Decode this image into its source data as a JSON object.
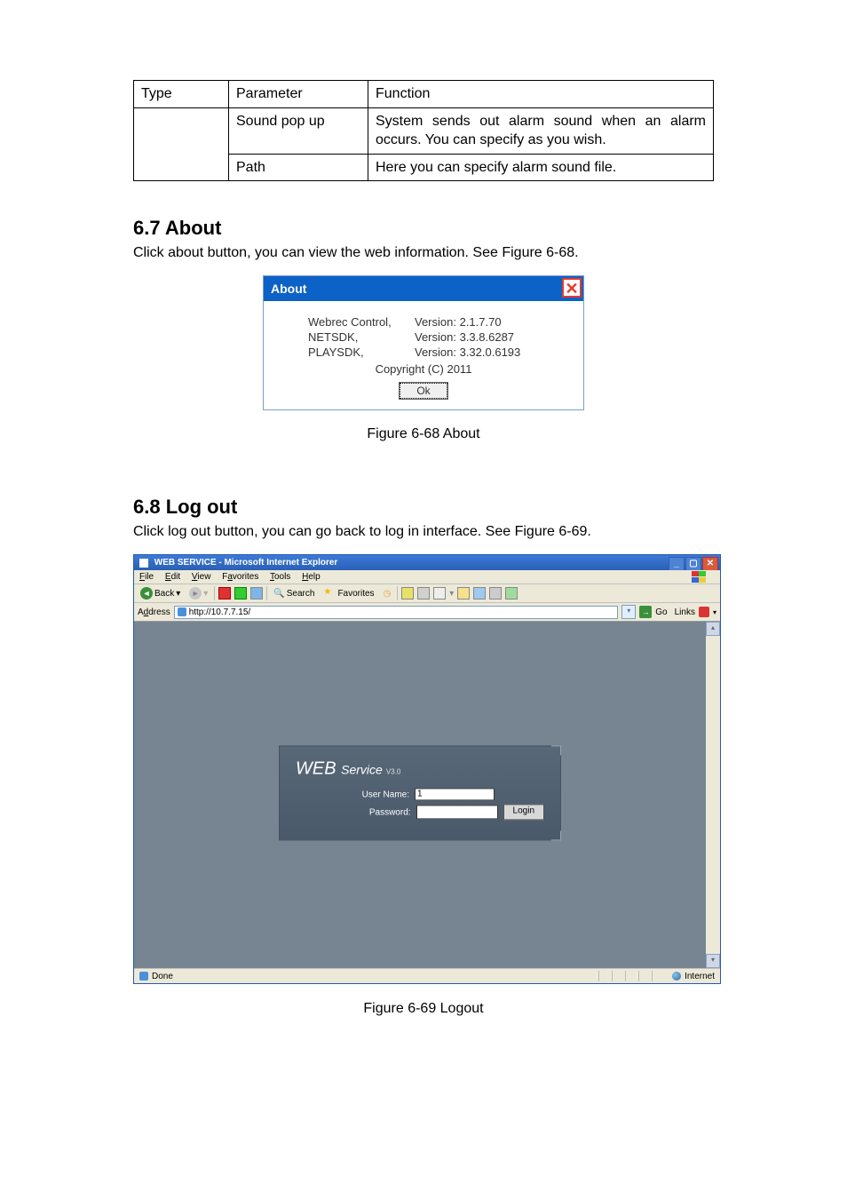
{
  "table": {
    "headers": [
      "Type",
      "Parameter",
      "Function"
    ],
    "rows": [
      {
        "type": "",
        "param": "Sound pop up",
        "func": "System sends out alarm sound when an alarm occurs. You can specify as you wish."
      },
      {
        "type": "",
        "param": "Path",
        "func": "Here you can specify alarm sound file."
      }
    ]
  },
  "section_about": {
    "heading": "6.7  About",
    "text": "Click about button, you can view the web information. See Figure 6-68.",
    "dialog": {
      "title": "About",
      "rows": [
        {
          "label": "Webrec Control,",
          "value": "Version: 2.1.7.70"
        },
        {
          "label": "NETSDK,",
          "value": "Version: 3.3.8.6287"
        },
        {
          "label": "PLAYSDK,",
          "value": "Version: 3.32.0.6193"
        }
      ],
      "copyright": "Copyright (C) 2011",
      "ok": "Ok"
    },
    "caption": "Figure 6-68 About"
  },
  "section_logout": {
    "heading": "6.8  Log out",
    "text": "Click log out button, you can go back to log in interface. See Figure 6-69.",
    "caption": "Figure 6-69 Logout"
  },
  "ie": {
    "title": "WEB SERVICE - Microsoft Internet Explorer",
    "menus": [
      "File",
      "Edit",
      "View",
      "Favorites",
      "Tools",
      "Help"
    ],
    "toolbar": {
      "back": "Back",
      "search": "Search",
      "favorites": "Favorites"
    },
    "addressbar": {
      "label": "Address",
      "value": "http://10.7.7.15/",
      "go": "Go",
      "links": "Links"
    },
    "login": {
      "brand": "WEB",
      "service": "Service",
      "version": "V3.0",
      "username_label": "User Name:",
      "password_label": "Password:",
      "username_value": "1",
      "login_btn": "Login"
    },
    "status": {
      "done": "Done",
      "zone": "Internet"
    }
  }
}
